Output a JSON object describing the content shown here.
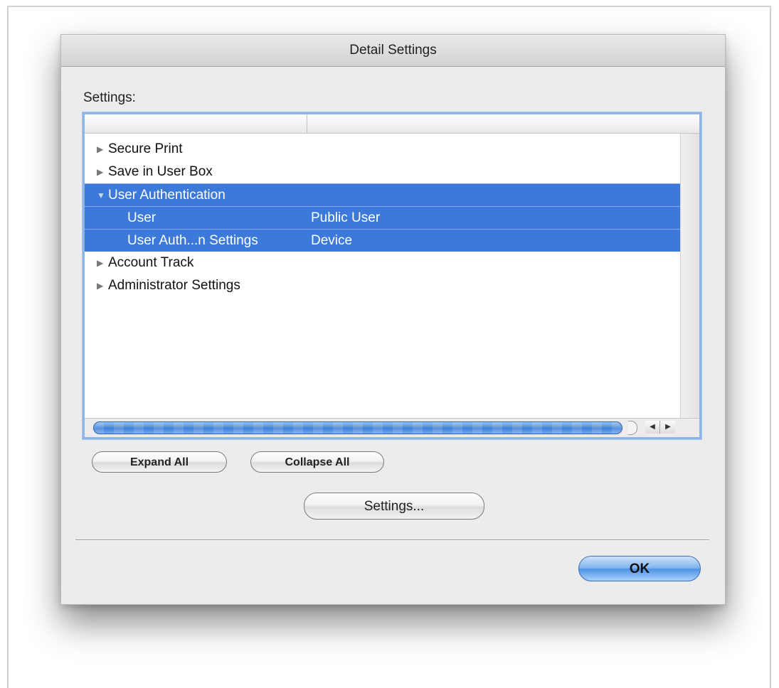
{
  "dialog": {
    "title": "Detail Settings",
    "settings_label": "Settings:",
    "tree": {
      "rows": [
        {
          "label": "Secure Print",
          "value": "",
          "expanded": false,
          "selected": false
        },
        {
          "label": "Save in User Box",
          "value": "",
          "expanded": false,
          "selected": false
        },
        {
          "label": "User Authentication",
          "value": "",
          "expanded": true,
          "selected": true
        },
        {
          "label": "User",
          "value": "Public User",
          "child": true,
          "selected": true
        },
        {
          "label": "User Auth...n Settings",
          "value": "Device",
          "child": true,
          "selected": true
        },
        {
          "label": "Account Track",
          "value": "",
          "expanded": false,
          "selected": false
        },
        {
          "label": "Administrator Settings",
          "value": "",
          "expanded": false,
          "selected": false
        }
      ]
    },
    "buttons": {
      "expand_all": "Expand All",
      "collapse_all": "Collapse All",
      "settings": "Settings...",
      "ok": "OK"
    },
    "colors": {
      "selection": "#3d79d8",
      "default_button": "#4e93e5"
    }
  }
}
